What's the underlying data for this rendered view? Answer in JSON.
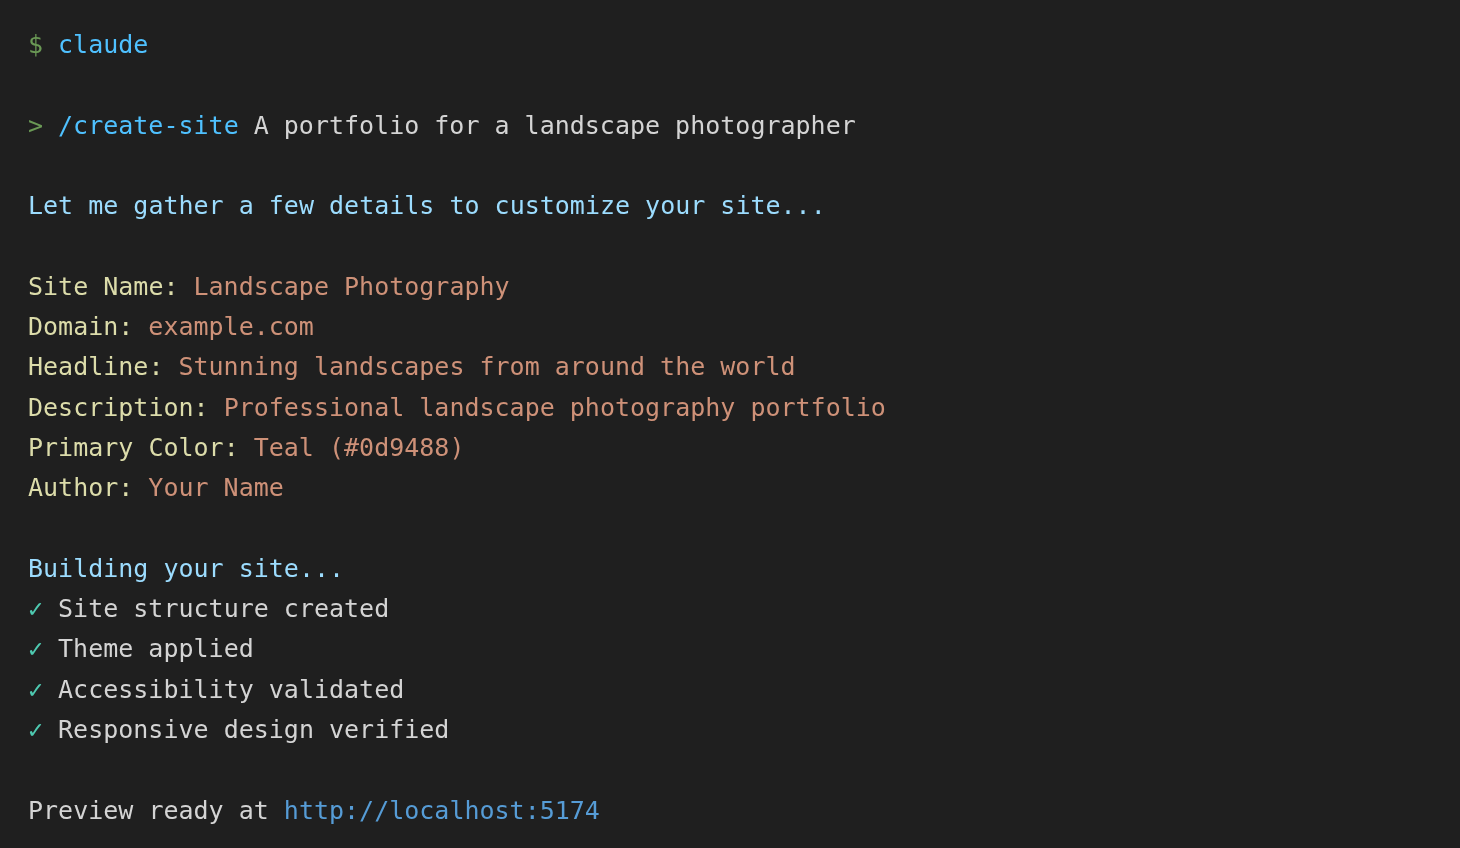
{
  "command": {
    "prompt": "$",
    "text": "claude"
  },
  "input": {
    "prompt": ">",
    "command": "/create-site",
    "text": "A portfolio for a landscape photographer"
  },
  "intro": "Let me gather a few details to customize your site...",
  "fields": [
    {
      "label": "Site Name:",
      "value": "Landscape Photography"
    },
    {
      "label": "Domain:",
      "value": "example.com"
    },
    {
      "label": "Headline:",
      "value": "Stunning landscapes from around the world"
    },
    {
      "label": "Description:",
      "value": "Professional landscape photography portfolio"
    },
    {
      "label": "Primary Color:",
      "value": "Teal (#0d9488)"
    },
    {
      "label": "Author:",
      "value": "Your Name"
    }
  ],
  "status": "Building your site...",
  "steps": [
    {
      "mark": "✓",
      "text": "Site structure created"
    },
    {
      "mark": "✓",
      "text": "Theme applied"
    },
    {
      "mark": "✓",
      "text": "Accessibility validated"
    },
    {
      "mark": "✓",
      "text": "Responsive design verified"
    }
  ],
  "preview": {
    "text": "Preview ready at",
    "link": "http://localhost:5174"
  }
}
